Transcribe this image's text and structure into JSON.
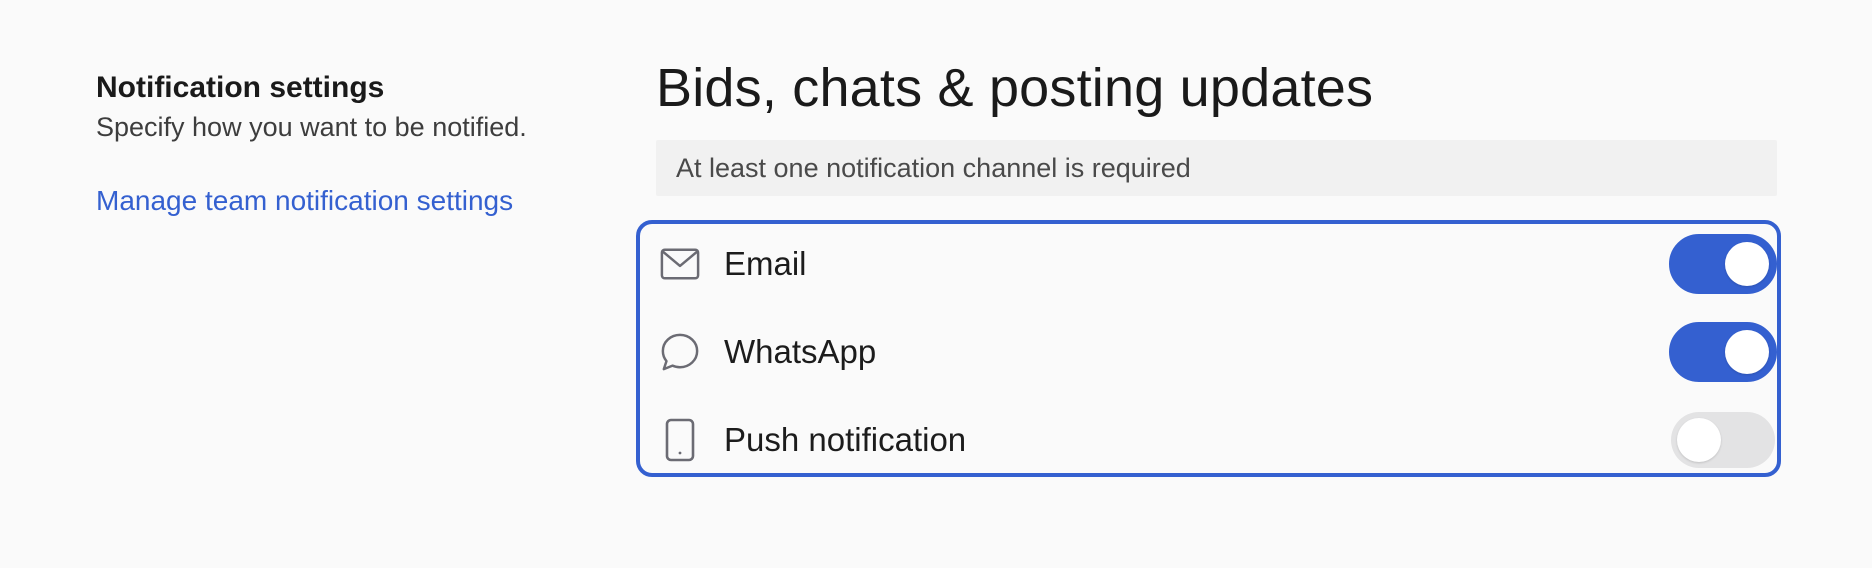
{
  "sidebar": {
    "title": "Notification settings",
    "subtitle": "Specify how you want to be notified.",
    "team_link": "Manage team notification settings"
  },
  "section": {
    "heading": "Bids, chats & posting updates",
    "notice": "At least one notification channel is required"
  },
  "channels": [
    {
      "label": "Email",
      "icon": "mail-icon",
      "enabled": true
    },
    {
      "label": "WhatsApp",
      "icon": "chat-bubble-icon",
      "enabled": true
    },
    {
      "label": "Push notification",
      "icon": "smartphone-icon",
      "enabled": false
    }
  ],
  "colors": {
    "accent": "#3460d0",
    "toggle_off": "#e3e3e4",
    "icon": "#6b6b73"
  }
}
